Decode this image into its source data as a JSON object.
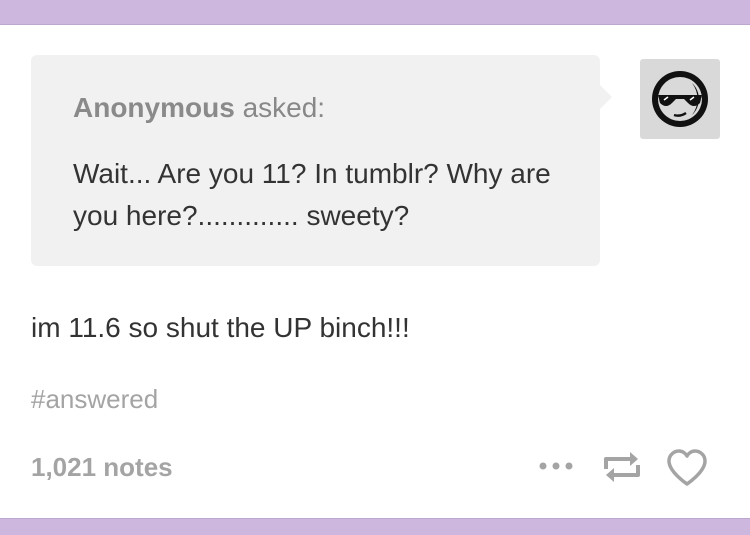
{
  "ask": {
    "asker_name": "Anonymous",
    "asked_word": "asked:",
    "question": "Wait... Are you 11? In tumblr? Why are you here?............. sweety?"
  },
  "answer": {
    "text": "im 11.6 so shut the UP binch!!!"
  },
  "tags": [
    "#answered"
  ],
  "footer": {
    "notes": "1,021 notes"
  },
  "icons": {
    "avatar": "sunglasses-face-avatar",
    "more": "more-dots-icon",
    "reblog": "reblog-icon",
    "like": "heart-icon"
  },
  "colors": {
    "band": "#cdb7de",
    "bubble": "#f1f1f1",
    "muted_text": "#a4a4a4",
    "body_text": "#333333"
  }
}
